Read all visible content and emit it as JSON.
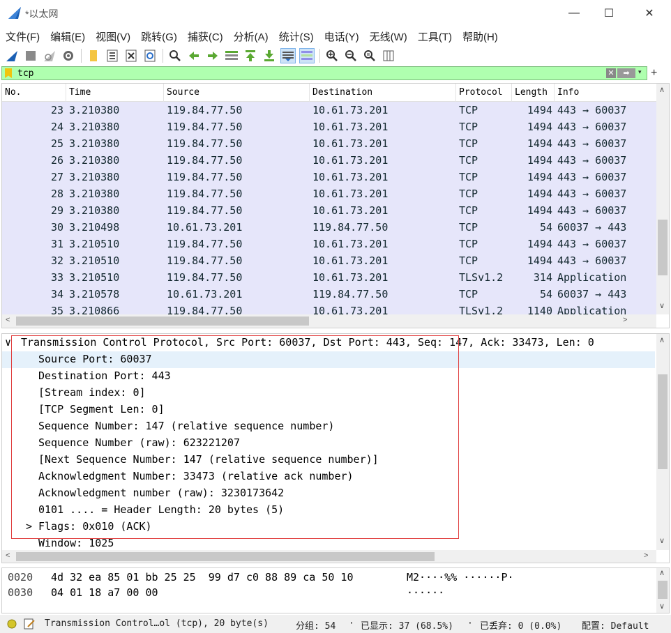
{
  "window": {
    "title": "*以太网",
    "min_glyph": "—",
    "max_glyph": "☐",
    "close_glyph": "✕",
    "accent": "#1a5fb4"
  },
  "menu": [
    "文件(F)",
    "编辑(E)",
    "视图(V)",
    "跳转(G)",
    "捕获(C)",
    "分析(A)",
    "统计(S)",
    "电话(Y)",
    "无线(W)",
    "工具(T)",
    "帮助(H)"
  ],
  "toolbar_icons": [
    "shark-fin-start-icon",
    "stop-square-icon",
    "restart-fin-icon",
    "capture-options-gear-icon",
    "open-folder-icon",
    "save-file-icon",
    "close-file-icon",
    "reload-icon",
    "find-magnifier-icon",
    "go-back-arrow-icon",
    "go-forward-arrow-icon",
    "go-to-packet-icon",
    "go-first-icon",
    "go-last-icon",
    "autoscroll-icon",
    "colorize-icon",
    "zoom-in-icon",
    "zoom-out-icon",
    "zoom-normal-icon",
    "resize-columns-icon"
  ],
  "filter": {
    "value": "tcp",
    "background": "#afffaf",
    "clear_glyph": "✕",
    "apply_glyph": "➡",
    "dropdown_glyph": "▾",
    "add_glyph": "+"
  },
  "packet_list": {
    "columns": [
      "No.",
      "Time",
      "Source",
      "Destination",
      "Protocol",
      "Length",
      "Info"
    ],
    "rows": [
      {
        "no": "23",
        "time": "3.210380",
        "src": "119.84.77.50",
        "dst": "10.61.73.201",
        "proto": "TCP",
        "len": "1494",
        "info": "443 → 60037"
      },
      {
        "no": "24",
        "time": "3.210380",
        "src": "119.84.77.50",
        "dst": "10.61.73.201",
        "proto": "TCP",
        "len": "1494",
        "info": "443 → 60037"
      },
      {
        "no": "25",
        "time": "3.210380",
        "src": "119.84.77.50",
        "dst": "10.61.73.201",
        "proto": "TCP",
        "len": "1494",
        "info": "443 → 60037"
      },
      {
        "no": "26",
        "time": "3.210380",
        "src": "119.84.77.50",
        "dst": "10.61.73.201",
        "proto": "TCP",
        "len": "1494",
        "info": "443 → 60037"
      },
      {
        "no": "27",
        "time": "3.210380",
        "src": "119.84.77.50",
        "dst": "10.61.73.201",
        "proto": "TCP",
        "len": "1494",
        "info": "443 → 60037"
      },
      {
        "no": "28",
        "time": "3.210380",
        "src": "119.84.77.50",
        "dst": "10.61.73.201",
        "proto": "TCP",
        "len": "1494",
        "info": "443 → 60037"
      },
      {
        "no": "29",
        "time": "3.210380",
        "src": "119.84.77.50",
        "dst": "10.61.73.201",
        "proto": "TCP",
        "len": "1494",
        "info": "443 → 60037"
      },
      {
        "no": "30",
        "time": "3.210498",
        "src": "10.61.73.201",
        "dst": "119.84.77.50",
        "proto": "TCP",
        "len": "54",
        "info": "60037 → 443"
      },
      {
        "no": "31",
        "time": "3.210510",
        "src": "119.84.77.50",
        "dst": "10.61.73.201",
        "proto": "TCP",
        "len": "1494",
        "info": "443 → 60037"
      },
      {
        "no": "32",
        "time": "3.210510",
        "src": "119.84.77.50",
        "dst": "10.61.73.201",
        "proto": "TCP",
        "len": "1494",
        "info": "443 → 60037"
      },
      {
        "no": "33",
        "time": "3.210510",
        "src": "119.84.77.50",
        "dst": "10.61.73.201",
        "proto": "TLSv1.2",
        "len": "314",
        "info": "Application"
      },
      {
        "no": "34",
        "time": "3.210578",
        "src": "10.61.73.201",
        "dst": "119.84.77.50",
        "proto": "TCP",
        "len": "54",
        "info": "60037 → 443"
      },
      {
        "no": "35",
        "time": "3.210866",
        "src": "119.84.77.50",
        "dst": "10.61.73.201",
        "proto": "TLSv1.2",
        "len": "1140",
        "info": "Application"
      }
    ],
    "row_color": "#e6e6fa",
    "scroll_up": "∧",
    "scroll_down": "∨",
    "scroll_left": "<",
    "scroll_right": ">"
  },
  "details": {
    "header": "Transmission Control Protocol, Src Port: 60037, Dst Port: 443, Seq: 147, Ack: 33473, Len: 0",
    "expand_glyph": "∨",
    "collapsed_glyph": ">",
    "fields": [
      "Source Port: 60037",
      "Destination Port: 443",
      "[Stream index: 0]",
      "[TCP Segment Len: 0]",
      "Sequence Number: 147    (relative sequence number)",
      "Sequence Number (raw): 623221207",
      "[Next Sequence Number: 147    (relative sequence number)]",
      "Acknowledgment Number: 33473    (relative ack number)",
      "Acknowledgment number (raw): 3230173642",
      "0101 .... = Header Length: 20 bytes (5)",
      "Flags: 0x010 (ACK)",
      "Window: 1025"
    ],
    "highlight_color": "#e5f1fb",
    "annotation_color": "#e04040"
  },
  "bytes": {
    "rows": [
      {
        "offset": "0020",
        "hex": "4d 32 ea 85 01 bb 25 25  99 d7 c0 88 89 ca 50 10",
        "ascii": "M2····%% ······P·"
      },
      {
        "offset": "0030",
        "hex": "04 01 18 a7 00 00",
        "ascii": "······"
      }
    ]
  },
  "status": {
    "indicator_color": "#d4c52a",
    "description": "Transmission Control…ol (tcp), 20 byte(s)",
    "packets": "分组: 54",
    "displayed": "已显示: 37 (68.5%)",
    "dropped": "已丢弃: 0 (0.0%)",
    "profile": "配置: Default"
  }
}
